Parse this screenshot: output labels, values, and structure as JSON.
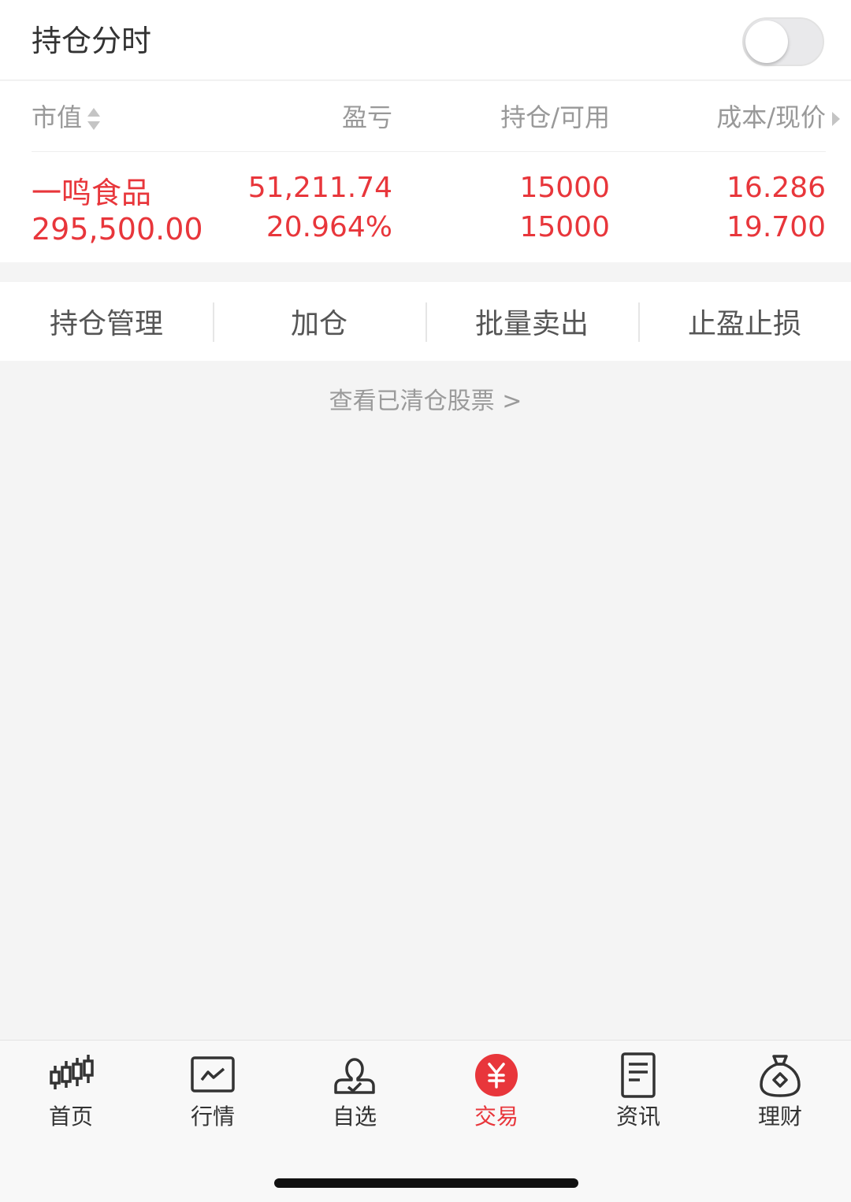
{
  "header": {
    "title": "持仓分时",
    "toggle_on": false
  },
  "table": {
    "columns": {
      "market_value": "市值",
      "profit_loss": "盈亏",
      "position": "持仓/可用",
      "cost_price": "成本/现价"
    },
    "rows": [
      {
        "name": "一鸣食品",
        "market_value": "295,500.00",
        "profit_loss": "51,211.74",
        "profit_loss_pct": "20.964%",
        "holding": "15000",
        "available": "15000",
        "cost": "16.286",
        "price": "19.700"
      }
    ]
  },
  "actions": [
    "持仓管理",
    "加仓",
    "批量卖出",
    "止盈止损"
  ],
  "cleared_link": "查看已清仓股票 >",
  "tabs": [
    {
      "label": "首页",
      "icon": "candlestick-icon"
    },
    {
      "label": "行情",
      "icon": "market-chart-icon"
    },
    {
      "label": "自选",
      "icon": "user-check-icon"
    },
    {
      "label": "交易",
      "icon": "yuan-icon"
    },
    {
      "label": "资讯",
      "icon": "document-icon"
    },
    {
      "label": "理财",
      "icon": "money-bag-icon"
    }
  ],
  "colors": {
    "accent": "#e8363b",
    "text_primary": "#333333",
    "text_secondary": "#999999",
    "background": "#f4f4f4"
  }
}
